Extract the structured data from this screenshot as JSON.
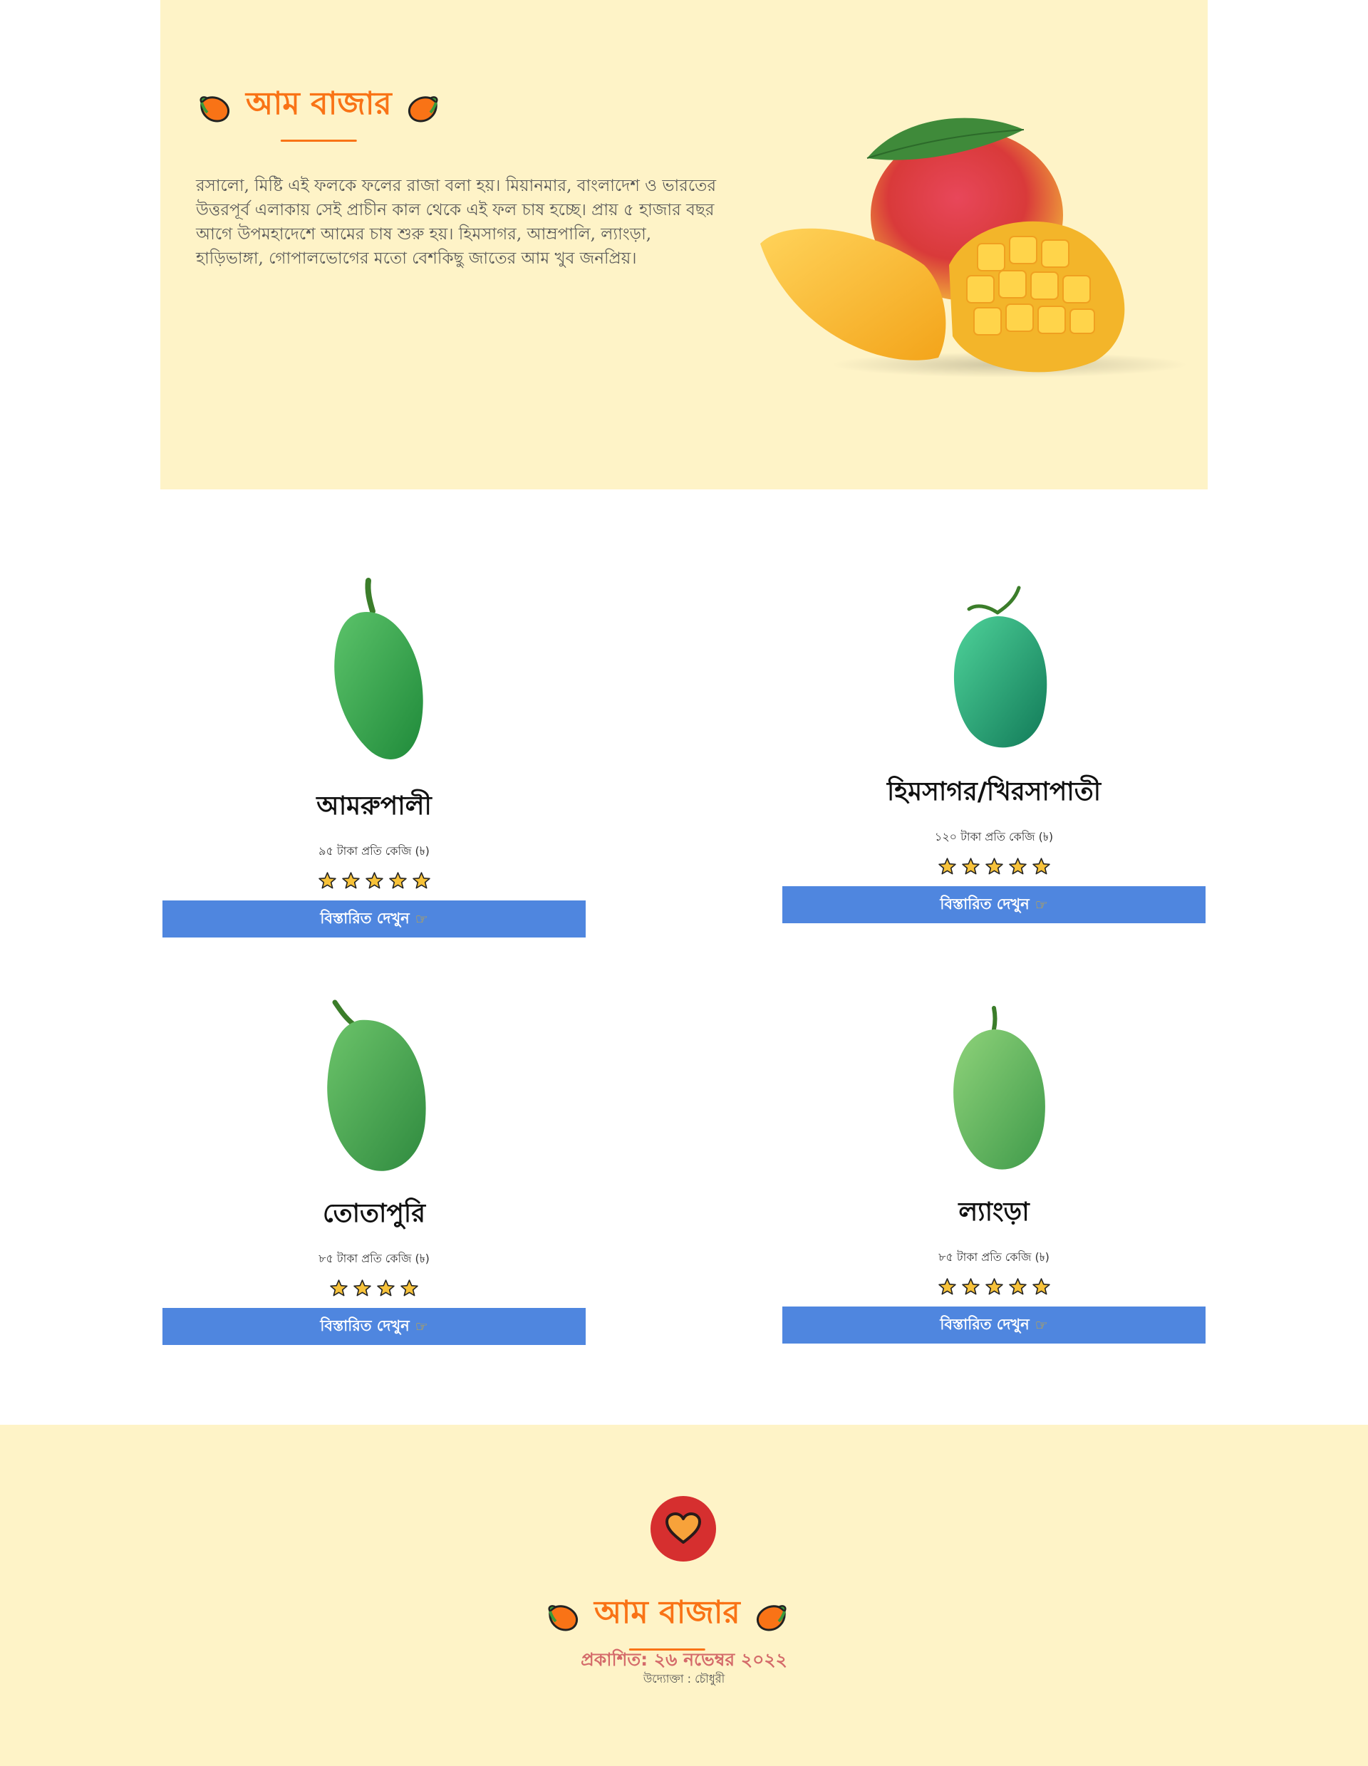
{
  "brand": {
    "title": "আম বাজার"
  },
  "hero": {
    "description": "রসালো, মিষ্টি এই ফলকে ফলের রাজা বলা হয়। মিয়ানমার, বাংলাদেশ ও ভারতের উত্তরপূর্ব এলাকায় সেই প্রাচীন কাল থেকে এই ফল চাষ হচ্ছে। প্রায় ৫ হাজার বছর আগে উপমহাদেশে আমের চাষ শুরু হয়। হিমসাগর, আম্রপালি, ল্যাংড়া, হাড়িভাঙ্গা, গোপালভোগের মতো বেশকিছু জাতের আম খুব জনপ্রিয়।"
  },
  "products": [
    {
      "name": "আমরুপালী",
      "price": "৯৫ টাকা প্রতি কেজি (৳)",
      "rating": 5,
      "button": "বিস্তারিত দেখুন"
    },
    {
      "name": "হিমসাগর/খিরসাপাতী",
      "price": "১২০ টাকা প্রতি কেজি (৳)",
      "rating": 5,
      "button": "বিস্তারিত দেখুন"
    },
    {
      "name": "তোতাপুরি",
      "price": "৮৫ টাকা প্রতি কেজি (৳)",
      "rating": 4,
      "button": "বিস্তারিত দেখুন"
    },
    {
      "name": "ল্যাংড়া",
      "price": "৮৫ টাকা প্রতি কেজি (৳)",
      "rating": 5,
      "button": "বিস্তারিত দেখুন"
    }
  ],
  "footer": {
    "title": "আম বাজার",
    "published": "প্রকাশিত: ২৬ নভেম্বর ২০২২",
    "owner": "উদ্যোক্তা : চৌধুরী"
  },
  "colors": {
    "brand_orange": "#f97316",
    "hero_bg": "#fef3c7",
    "button_blue": "#4f86df",
    "heart_red": "#d62f2f",
    "star_yellow": "#f5b301"
  },
  "icons": {
    "brand": "mango-icon",
    "rating": "star-icon",
    "button": "pointing-hand-icon",
    "footer": "heart-icon"
  }
}
